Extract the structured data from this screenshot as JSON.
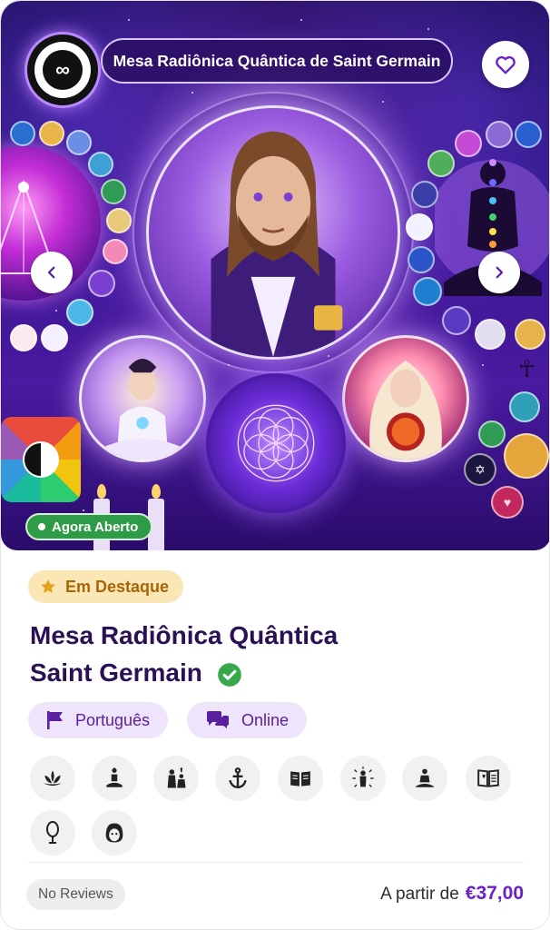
{
  "hero": {
    "title": "Mesa Radiônica Quântica de Saint Germain",
    "status": "Agora Aberto"
  },
  "featured_label": "Em Destaque",
  "listing": {
    "title_line1": "Mesa Radiônica Quântica",
    "title_line2": "Saint Germain",
    "verified": true
  },
  "tags": [
    {
      "label": "Português",
      "icon": "flag-icon"
    },
    {
      "label": "Online",
      "icon": "chat-bubbles-icon"
    }
  ],
  "symbols": [
    "lotus-icon",
    "meditation-figure-icon",
    "priest-icon",
    "anchor-icon",
    "open-book-icon",
    "radiant-figure-icon",
    "yoga-pose-icon",
    "heart-book-icon",
    "mirror-icon",
    "tarot-reader-icon"
  ],
  "reviews_label": "No Reviews",
  "price": {
    "prefix": "A partir de",
    "amount": "€37,00"
  },
  "colors": {
    "brand_purple": "#6b21c8",
    "title_navy": "#2a1156",
    "open_green": "#2e9b46",
    "featured_bg": "#fbe7b6",
    "featured_text": "#a7650a",
    "tag_bg": "#eee4fb"
  }
}
